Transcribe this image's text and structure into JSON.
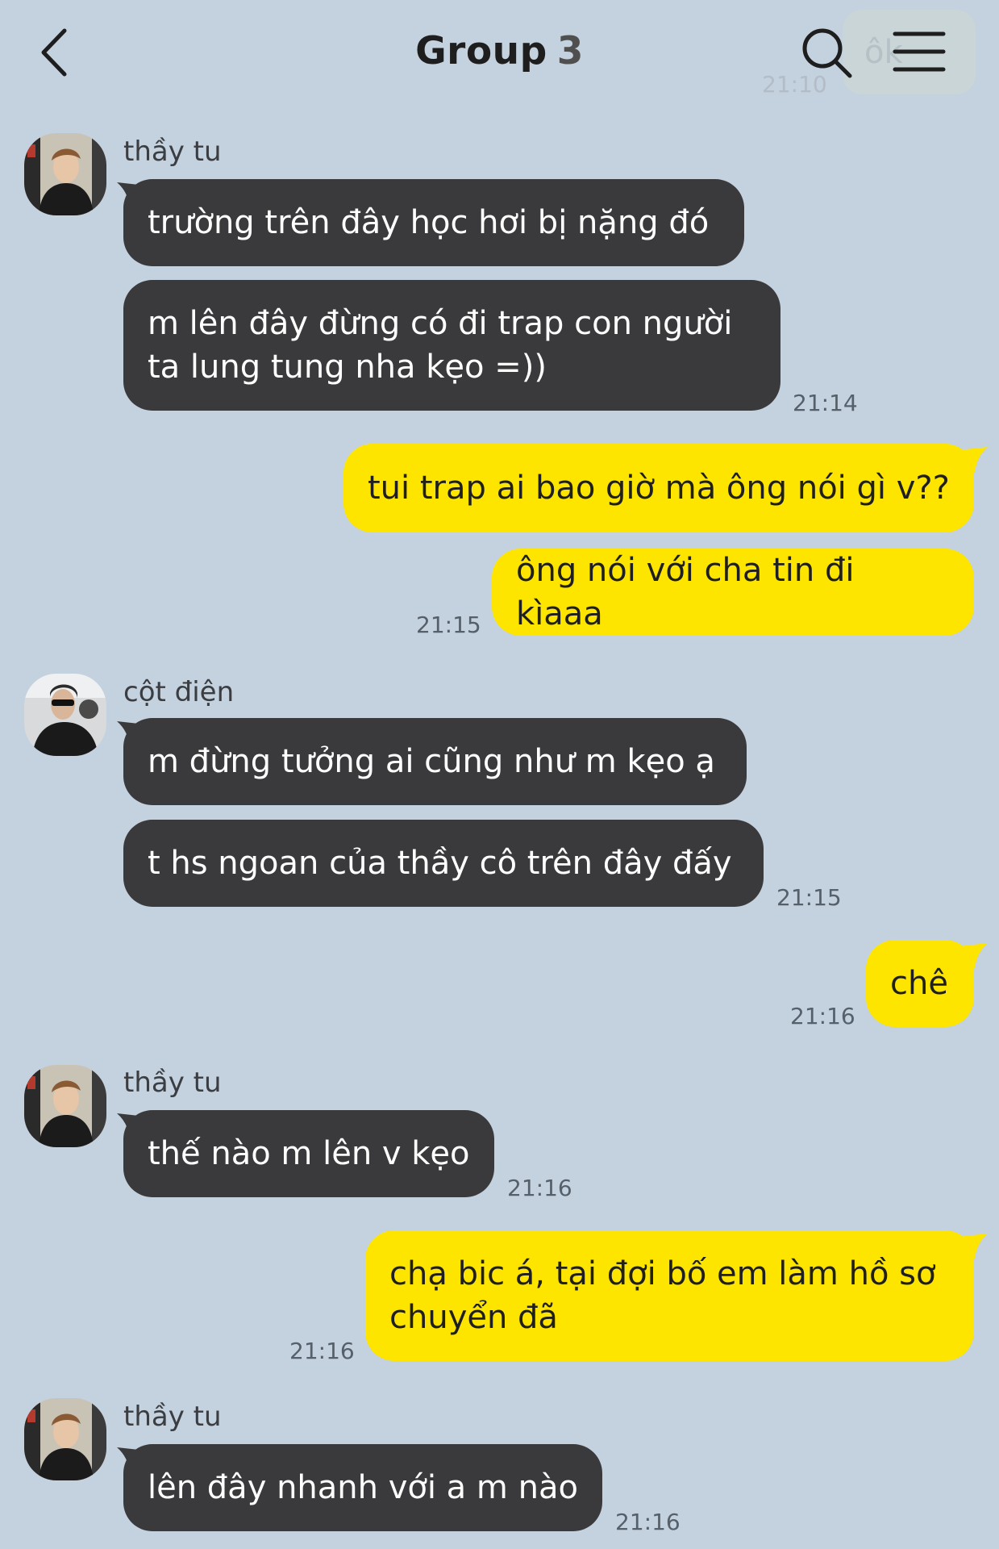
{
  "header": {
    "title": "Group",
    "member_count": "3",
    "back_icon": "chevron-left-icon",
    "search_icon": "search-icon",
    "menu_icon": "hamburger-menu-icon",
    "behind_text": "ôk",
    "behind_time": "21:10"
  },
  "colors": {
    "background": "#c4d1de",
    "incoming_bubble": "#3a3a3c",
    "outgoing_bubble": "#fde500"
  },
  "messages": [
    {
      "sender": "thầy tu",
      "text": "trường trên đây học hơi bị nặng đó"
    },
    {
      "text": "m lên đây đừng có đi trap con người\nta lung tung nha kẹo =))",
      "time": "21:14"
    },
    {
      "text": "tui trap ai bao giờ mà ông nói gì v??"
    },
    {
      "text": "ông nói với cha tin đi kìaaa",
      "time": "21:15"
    },
    {
      "sender": "cột điện",
      "text": "m đừng tưởng ai cũng như m kẹo ạ"
    },
    {
      "text": "t hs ngoan của thầy cô trên đây đấy",
      "time": "21:15"
    },
    {
      "text": "chê",
      "time": "21:16"
    },
    {
      "sender": "thầy tu",
      "text": "thế nào m lên v kẹo",
      "time": "21:16"
    },
    {
      "text": "chạ bic á, tại đợi bố em làm hồ sơ\nchuyển đã",
      "time": "21:16"
    },
    {
      "sender": "thầy tu",
      "text": "lên đây nhanh với a m nào",
      "time": "21:16"
    }
  ]
}
